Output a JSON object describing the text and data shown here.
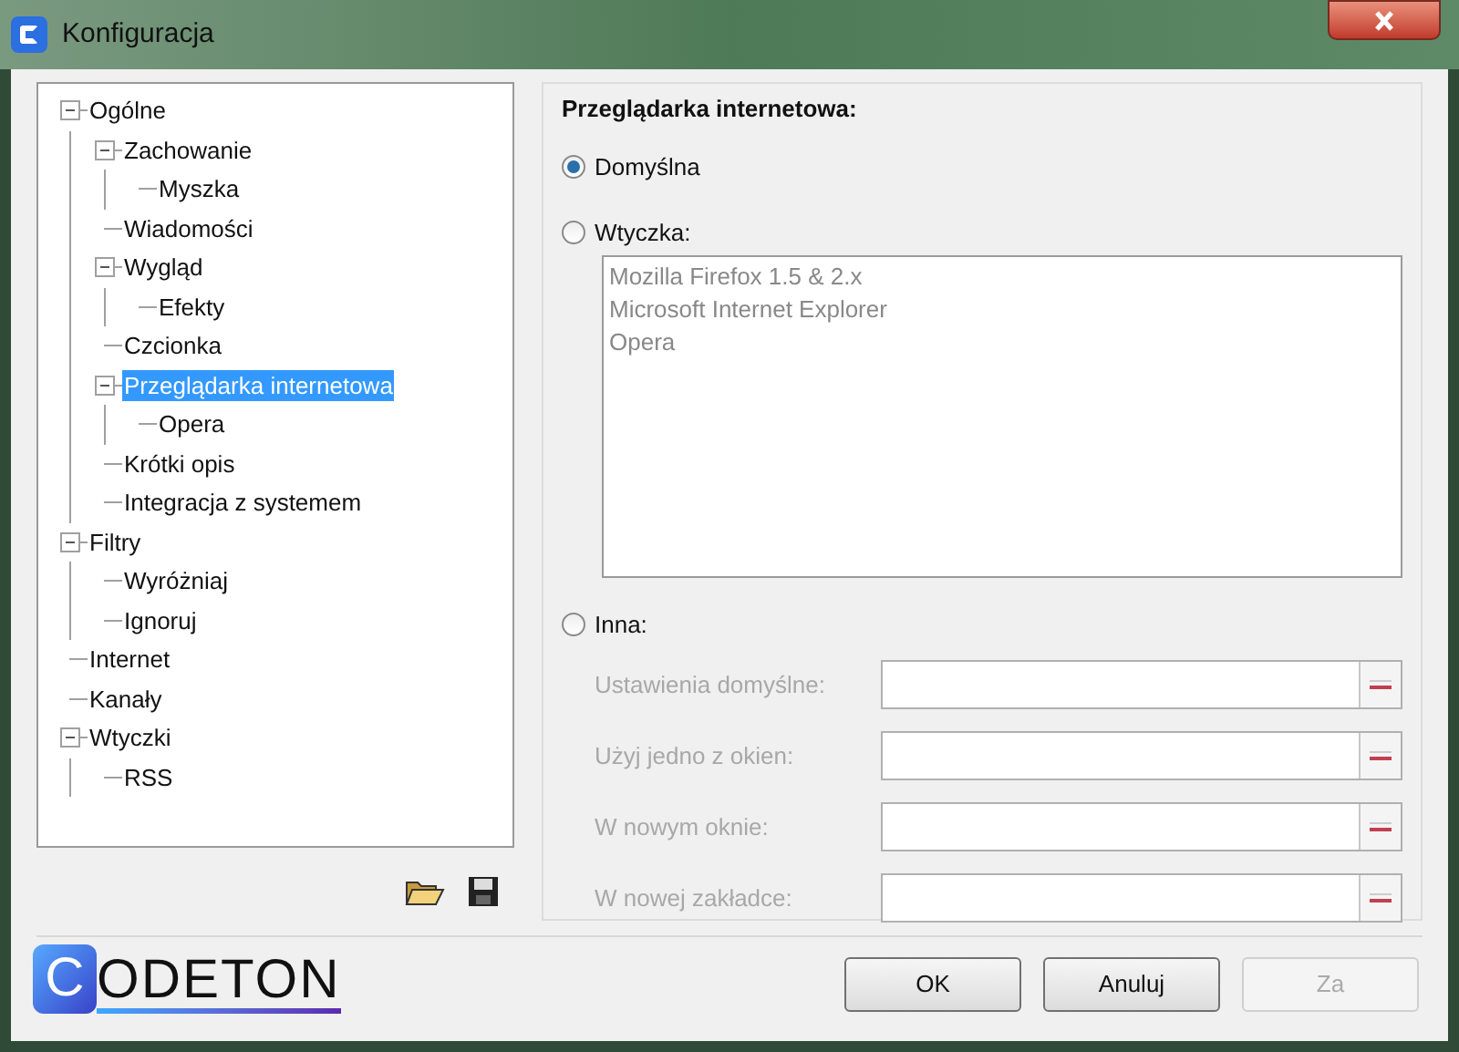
{
  "window": {
    "title": "Konfiguracja"
  },
  "tree": [
    {
      "label": "Ogólne",
      "expanded": true,
      "selected": false,
      "children": [
        {
          "label": "Zachowanie",
          "expanded": true,
          "selected": false,
          "children": [
            {
              "label": "Myszka",
              "selected": false
            }
          ]
        },
        {
          "label": "Wiadomości",
          "selected": false
        },
        {
          "label": "Wygląd",
          "expanded": true,
          "selected": false,
          "children": [
            {
              "label": "Efekty",
              "selected": false
            }
          ]
        },
        {
          "label": "Czcionka",
          "selected": false
        },
        {
          "label": "Przeglądarka internetowa",
          "expanded": true,
          "selected": true,
          "children": [
            {
              "label": "Opera",
              "selected": false
            }
          ]
        },
        {
          "label": "Krótki opis",
          "selected": false
        },
        {
          "label": "Integracja z systemem",
          "selected": false
        }
      ]
    },
    {
      "label": "Filtry",
      "expanded": true,
      "selected": false,
      "children": [
        {
          "label": "Wyróżniaj",
          "selected": false
        },
        {
          "label": "Ignoruj",
          "selected": false
        }
      ]
    },
    {
      "label": "Internet",
      "selected": false
    },
    {
      "label": "Kanały",
      "selected": false
    },
    {
      "label": "Wtyczki",
      "expanded": true,
      "selected": false,
      "children": [
        {
          "label": "RSS",
          "selected": false
        }
      ]
    }
  ],
  "browser": {
    "heading": "Przeglądarka internetowa:",
    "options": [
      {
        "label": "Domyślna",
        "selected": true
      },
      {
        "label": "Wtyczka:",
        "selected": false
      },
      {
        "label": "Inna:",
        "selected": false
      }
    ],
    "plugins": {
      "disabled": true,
      "items": [
        "Mozilla Firefox 1.5 & 2.x",
        "Microsoft Internet Explorer",
        "Opera"
      ]
    },
    "fields": [
      {
        "label": "Ustawienia domyślne:",
        "disabled": true
      },
      {
        "label": "Użyj jedno z okien:",
        "disabled": true
      },
      {
        "label": "W nowym oknie:",
        "disabled": true
      },
      {
        "label": "W nowej zakładce:",
        "disabled": true
      }
    ]
  },
  "logo": {
    "initial": "C",
    "rest": "ODETON"
  },
  "buttons": [
    {
      "label": "OK",
      "disabled": false
    },
    {
      "label": "Anuluj",
      "disabled": false
    },
    {
      "label": "Za",
      "disabled": true
    }
  ]
}
